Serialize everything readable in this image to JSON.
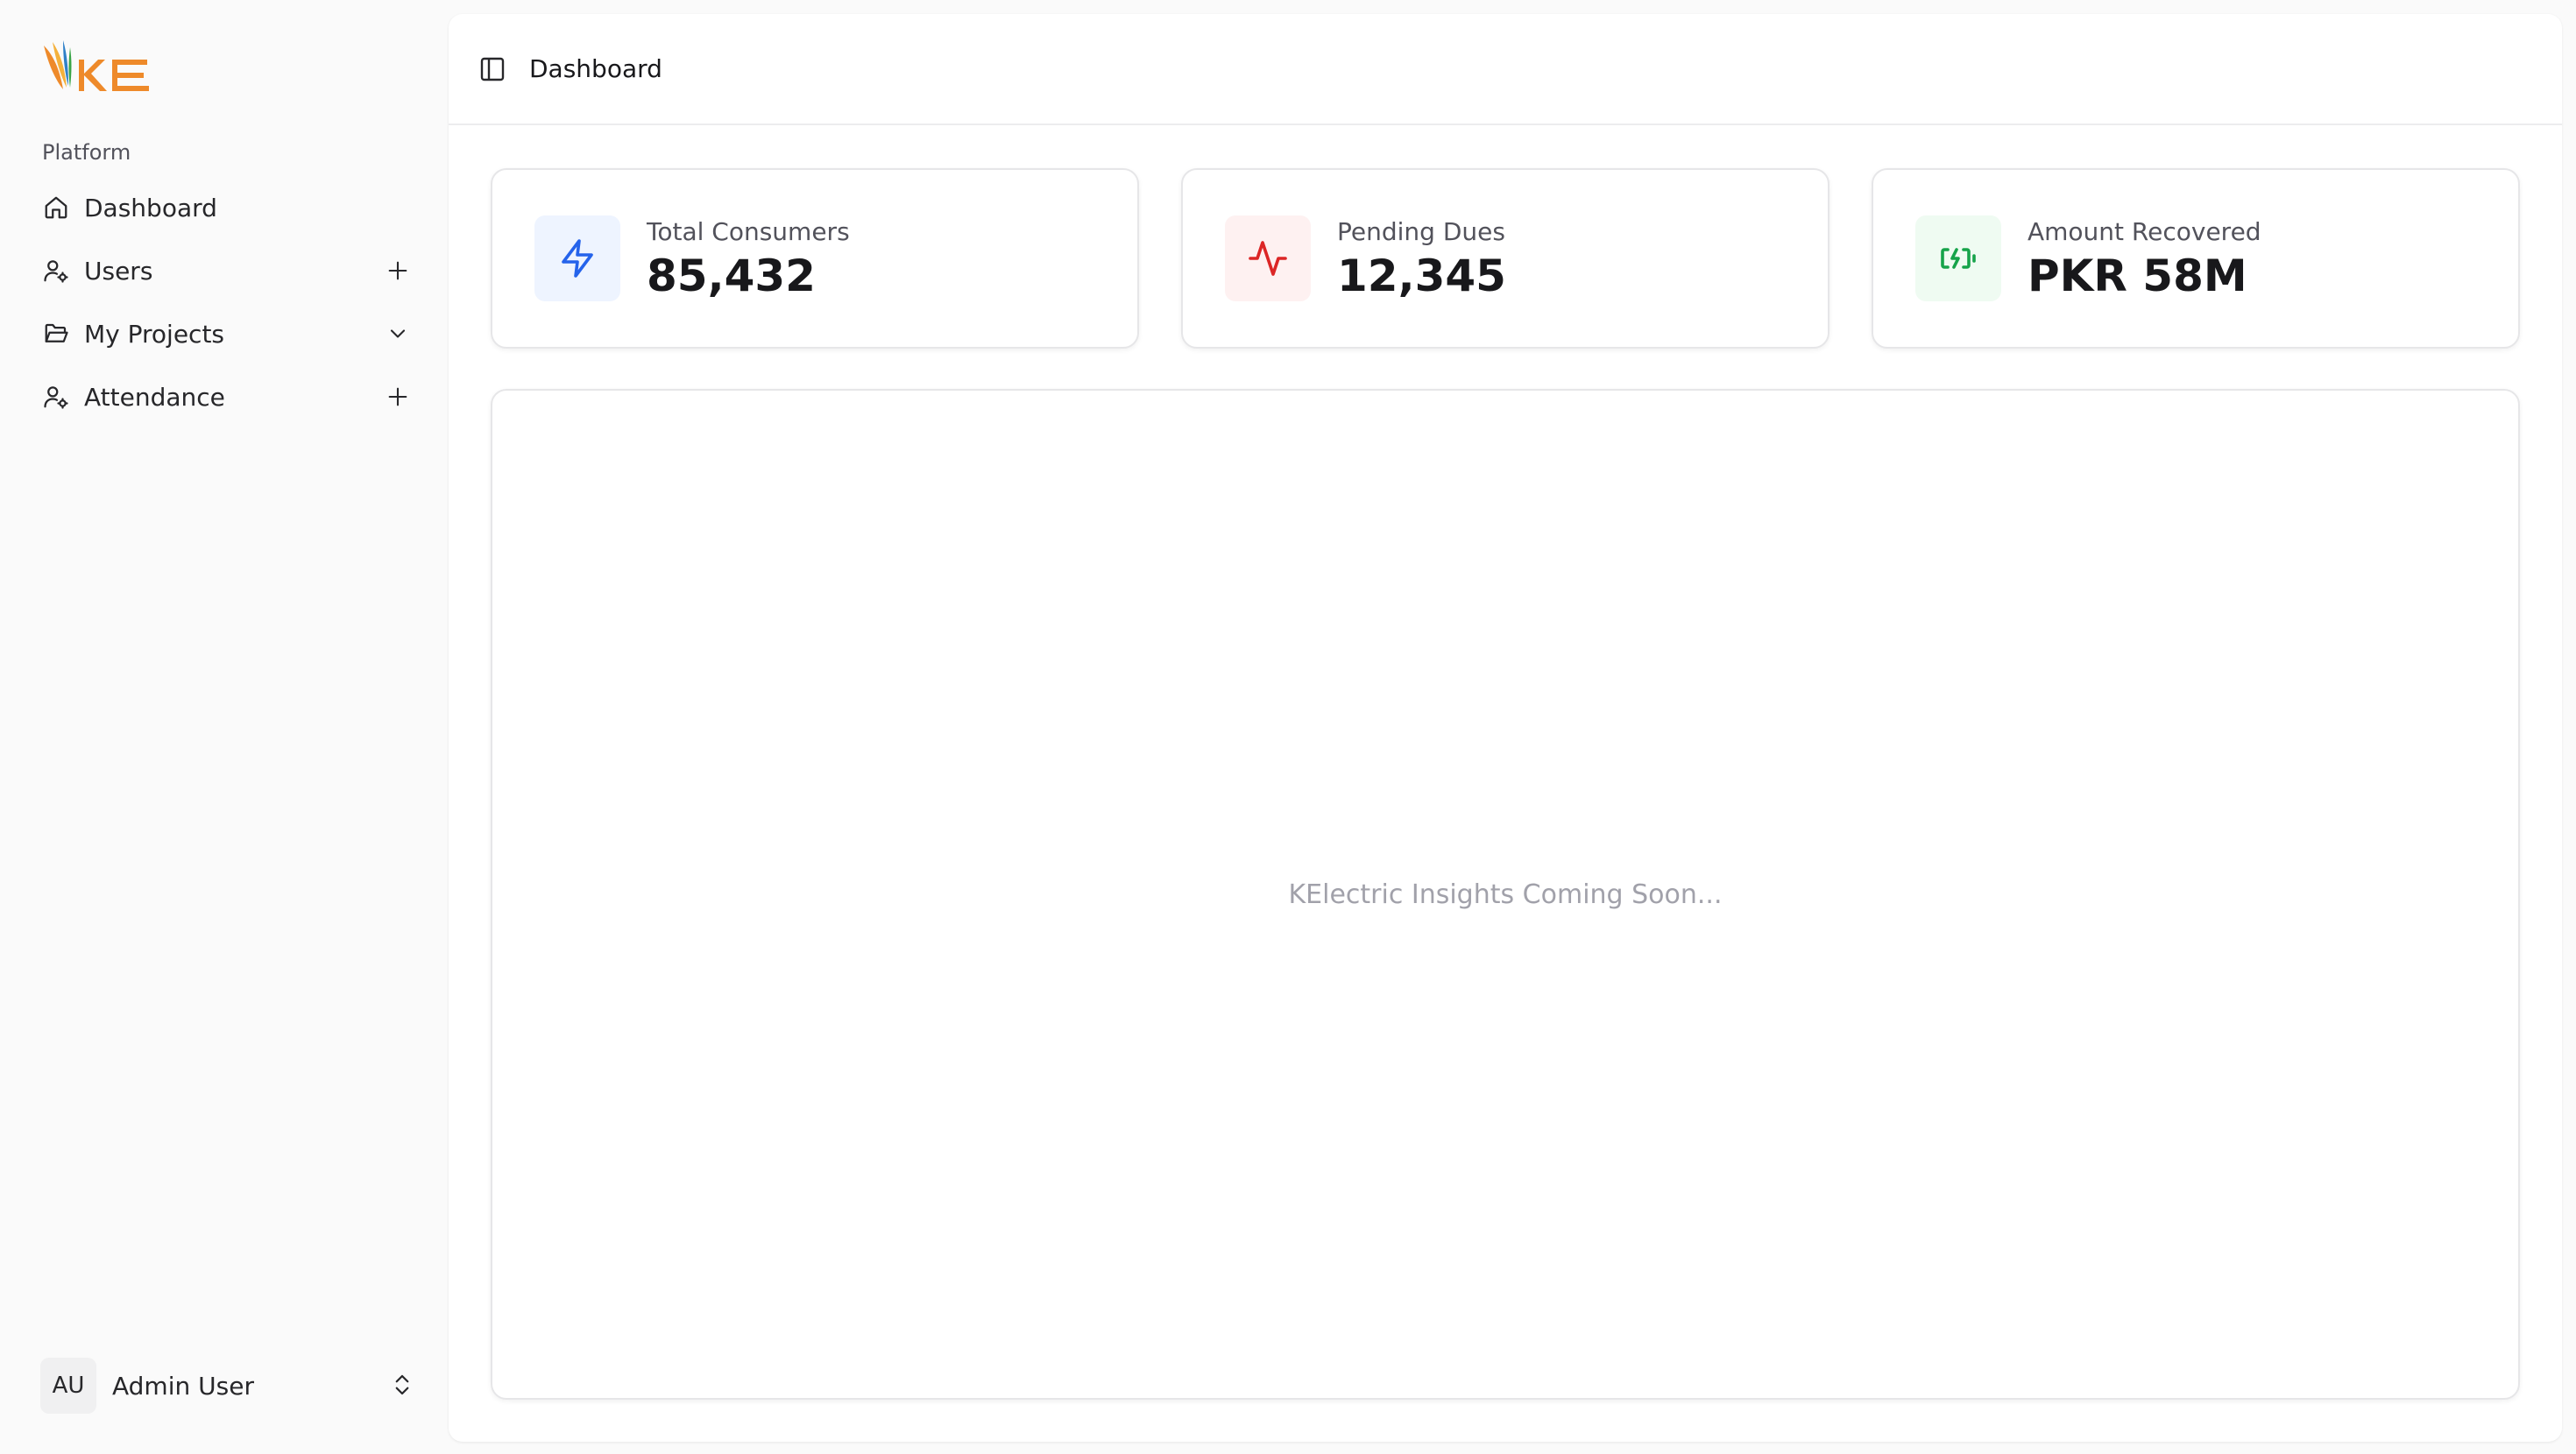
{
  "brand": {
    "logo_text": "KE",
    "orange": "#ee8a2a",
    "blue": "#2f80c8",
    "green": "#3aa548"
  },
  "sidebar": {
    "group_label": "Platform",
    "items": [
      {
        "label": "Dashboard",
        "icon": "home-icon",
        "trailing": ""
      },
      {
        "label": "Users",
        "icon": "user-gear-icon",
        "trailing": "plus-icon"
      },
      {
        "label": "My Projects",
        "icon": "folder-open-icon",
        "trailing": "chevron-down-icon"
      },
      {
        "label": "Attendance",
        "icon": "user-gear-icon",
        "trailing": "plus-icon"
      }
    ],
    "user": {
      "initials": "AU",
      "name": "Admin User",
      "icon": "chevrons-up-down-icon"
    }
  },
  "header": {
    "toggle_icon": "sidebar-toggle-icon",
    "breadcrumb": "Dashboard"
  },
  "stats": [
    {
      "label": "Total Consumers",
      "value": "85,432",
      "icon": "zap-icon",
      "icon_color": "#2563eb",
      "icon_bg": "#eef4ff"
    },
    {
      "label": "Pending Dues",
      "value": "12,345",
      "icon": "activity-icon",
      "icon_color": "#dc2626",
      "icon_bg": "#fef1f1"
    },
    {
      "label": "Amount Recovered",
      "value": "PKR 58M",
      "icon": "battery-charging-icon",
      "icon_color": "#16a34a",
      "icon_bg": "#effbf2"
    }
  ],
  "insights": {
    "message": "KElectric Insights Coming Soon..."
  }
}
